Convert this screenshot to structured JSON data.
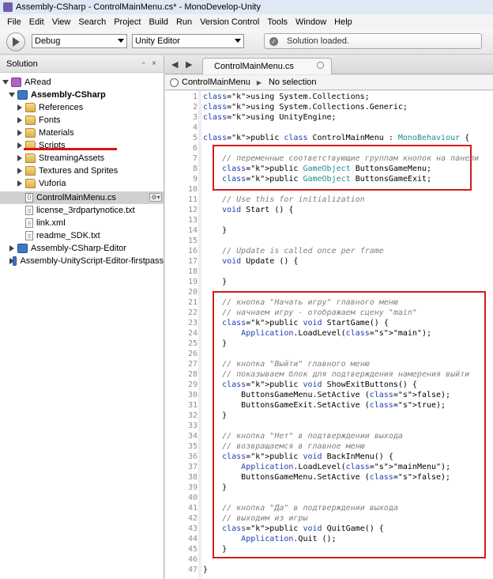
{
  "window": {
    "title": "Assembly-CSharp - ControlMainMenu.cs* - MonoDevelop-Unity"
  },
  "menubar": [
    "File",
    "Edit",
    "View",
    "Search",
    "Project",
    "Build",
    "Run",
    "Version Control",
    "Tools",
    "Window",
    "Help"
  ],
  "toolbar": {
    "configuration": "Debug",
    "target": "Unity Editor",
    "status": "Solution loaded."
  },
  "solution": {
    "title": "Solution",
    "pane_controls": "▫ ×",
    "items": [
      {
        "label": "ARead",
        "icon": "solution-icon"
      },
      {
        "label": "Assembly-CSharp",
        "icon": "project-icon"
      },
      {
        "label": "References",
        "icon": "folder-icon"
      },
      {
        "label": "Fonts",
        "icon": "folder-icon"
      },
      {
        "label": "Materials",
        "icon": "folder-icon"
      },
      {
        "label": "Scripts",
        "icon": "folder-icon"
      },
      {
        "label": "StreamingAssets",
        "icon": "folder-icon"
      },
      {
        "label": "Textures and Sprites",
        "icon": "folder-icon"
      },
      {
        "label": "Vuforia",
        "icon": "folder-icon"
      },
      {
        "label": "ControlMainMenu.cs",
        "icon": "cs-file-icon"
      },
      {
        "label": "license_3rdpartynotice.txt",
        "icon": "text-file-icon"
      },
      {
        "label": "link.xml",
        "icon": "text-file-icon"
      },
      {
        "label": "readme_SDK.txt",
        "icon": "text-file-icon"
      },
      {
        "label": "Assembly-CSharp-Editor",
        "icon": "project-icon"
      },
      {
        "label": "Assembly-UnityScript-Editor-firstpass",
        "icon": "project-icon"
      }
    ]
  },
  "editor": {
    "tab": "ControlMainMenu.cs",
    "breadcrumb": {
      "class_name": "ControlMainMenu",
      "member": "No selection"
    },
    "lines": [
      "using System.Collections;",
      "using System.Collections.Generic;",
      "using UnityEngine;",
      "",
      "public class ControlMainMenu : MonoBehaviour {",
      "",
      "    // переменные соответствующие группам кнопок на панели",
      "    public GameObject ButtonsGameMenu;",
      "    public GameObject ButtonsGameExit;",
      "",
      "    // Use this for initialization",
      "    void Start () {",
      "",
      "    }",
      "",
      "    // Update is called once per frame",
      "    void Update () {",
      "",
      "    }",
      "",
      "    // кнопка \"Начать игру\" главного меню",
      "    // начнаем игру - отображаем сцену \"main\"",
      "    public void StartGame() {",
      "        Application.LoadLevel(\"main\");",
      "    }",
      "",
      "    // кнопка \"Выйти\" главного меню",
      "    // показываем блок для подтверждения намерения выйти",
      "    public void ShowExitButtons() {",
      "        ButtonsGameMenu.SetActive (false);",
      "        ButtonsGameExit.SetActive (true);",
      "    }",
      "",
      "    // кнопка \"Нет\" в подтверждении выхода",
      "    // возвращаемся в главное меню",
      "    public void BackInMenu() {",
      "        Application.LoadLevel(\"mainMenu\");",
      "        ButtonsGameMenu.SetActive (false);",
      "    }",
      "",
      "    // кнопка \"Да\" в подтверждении выхода",
      "    // выходим из игры",
      "    public void QuitGame() {",
      "        Application.Quit ();",
      "    }",
      "",
      "}"
    ]
  },
  "colors": {
    "keyword": "#1a3fb0",
    "type": "#208c8c",
    "comment": "#7f7f7f",
    "string": "#b03c8c",
    "annotation_box": "#d31a1a"
  }
}
